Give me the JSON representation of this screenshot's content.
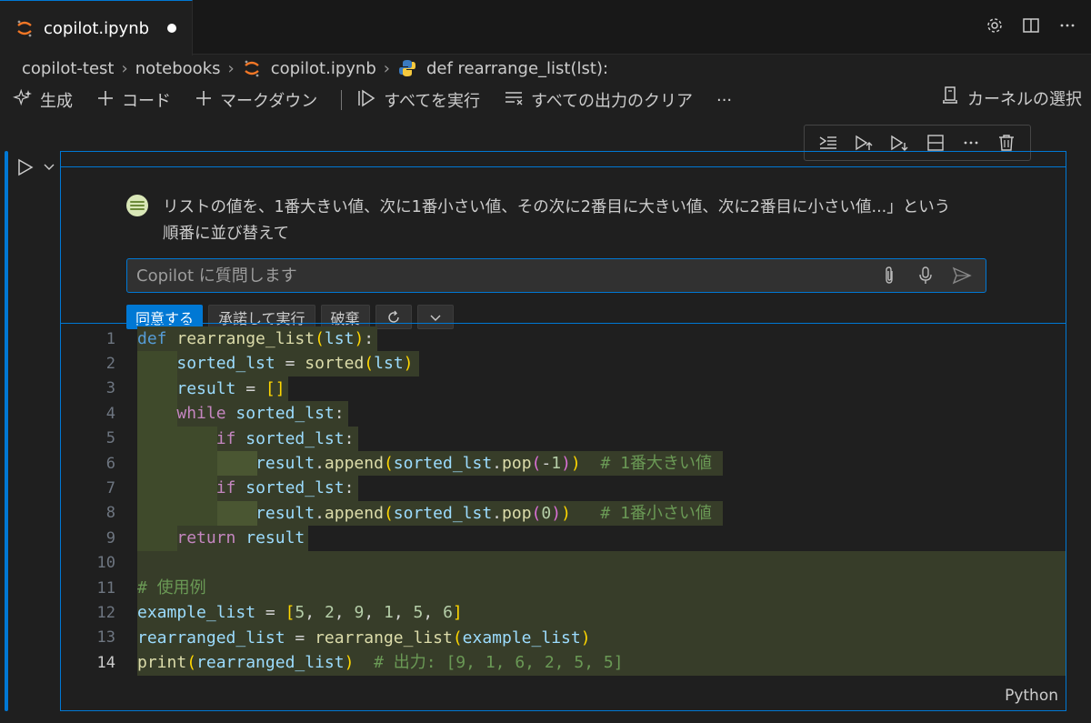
{
  "tab": {
    "title": "copilot.ipynb"
  },
  "breadcrumb": {
    "items": [
      "copilot-test",
      "notebooks",
      "copilot.ipynb",
      "def rearrange_list(lst):"
    ]
  },
  "toolbar": {
    "generate": "生成",
    "code": "コード",
    "markdown": "マークダウン",
    "run_all": "すべてを実行",
    "clear_outputs": "すべての出力のクリア",
    "more": "···",
    "kernel": "カーネルの選択"
  },
  "chat": {
    "message": "リストの値を、1番大きい値、次に1番小さい値、その次に2番目に大きい値、次に2番目に小さい値...」という順番に並び替えて",
    "placeholder": "Copilot に質問します",
    "accept": "同意する",
    "accept_run": "承諾して実行",
    "discard": "破棄"
  },
  "editor": {
    "line_numbers": [
      "1",
      "2",
      "3",
      "4",
      "5",
      "6",
      "7",
      "8",
      "9",
      "10",
      "11",
      "12",
      "13",
      "14"
    ],
    "language": "Python"
  },
  "colors": {
    "accent": "#0078d4",
    "diff_added": "#373d29"
  }
}
